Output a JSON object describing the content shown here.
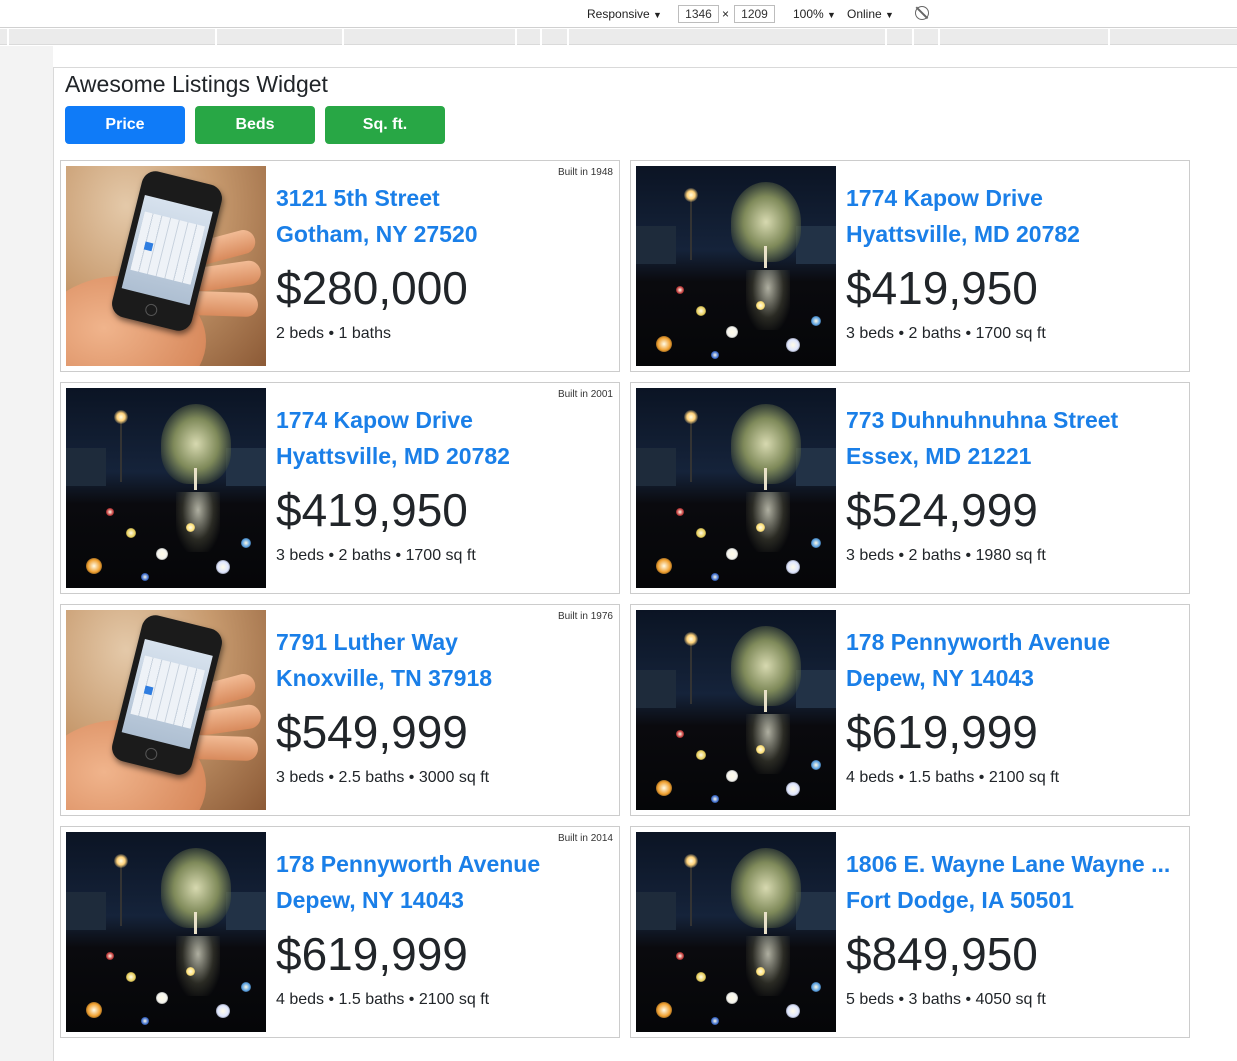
{
  "devtools": {
    "mode": "Responsive",
    "width": "1346",
    "times": "×",
    "height": "1209",
    "zoom": "100%",
    "network": "Online",
    "caret": "▼"
  },
  "widget": {
    "title": "Awesome Listings Widget",
    "buttons": [
      {
        "label": "Price",
        "color": "#0f7bf8"
      },
      {
        "label": "Beds",
        "color": "#28a745"
      },
      {
        "label": "Sq. ft.",
        "color": "#28a745"
      }
    ]
  },
  "listings": [
    {
      "photo": "phone-photo",
      "built": "Built in 1948",
      "street": "3121 5th Street",
      "city": "Gotham, NY 27520",
      "price": "$280,000",
      "facts": "2 beds • 1 baths"
    },
    {
      "photo": "night-tree-photo",
      "built": "",
      "street": "1774 Kapow Drive",
      "city": "Hyattsville, MD 20782",
      "price": "$419,950",
      "facts": "3 beds • 2 baths • 1700 sq ft"
    },
    {
      "photo": "night-tree-photo",
      "built": "Built in 2001",
      "street": "1774 Kapow Drive",
      "city": "Hyattsville, MD 20782",
      "price": "$419,950",
      "facts": "3 beds • 2 baths • 1700 sq ft"
    },
    {
      "photo": "night-tree-photo",
      "built": "",
      "street": "773 Duhnuhnuhna Street",
      "city": "Essex, MD 21221",
      "price": "$524,999",
      "facts": "3 beds • 2 baths • 1980 sq ft"
    },
    {
      "photo": "phone-photo",
      "built": "Built in 1976",
      "street": "7791 Luther Way",
      "city": "Knoxville, TN 37918",
      "price": "$549,999",
      "facts": "3 beds • 2.5 baths • 3000 sq ft"
    },
    {
      "photo": "night-tree-photo",
      "built": "",
      "street": "178 Pennyworth Avenue",
      "city": "Depew, NY 14043",
      "price": "$619,999",
      "facts": "4 beds • 1.5 baths • 2100 sq ft"
    },
    {
      "photo": "night-tree-photo",
      "built": "Built in 2014",
      "street": "178 Pennyworth Avenue",
      "city": "Depew, NY 14043",
      "price": "$619,999",
      "facts": "4 beds • 1.5 baths • 2100 sq ft"
    },
    {
      "photo": "night-tree-photo",
      "built": "",
      "street": "1806 E. Wayne Lane Wayne ...",
      "city": "Fort Dodge, IA 50501",
      "price": "$849,950",
      "facts": "5 beds • 3 baths • 4050 sq ft"
    }
  ],
  "colors": {
    "link": "#1a7fe8",
    "text": "#212529",
    "border": "#cccccc"
  }
}
